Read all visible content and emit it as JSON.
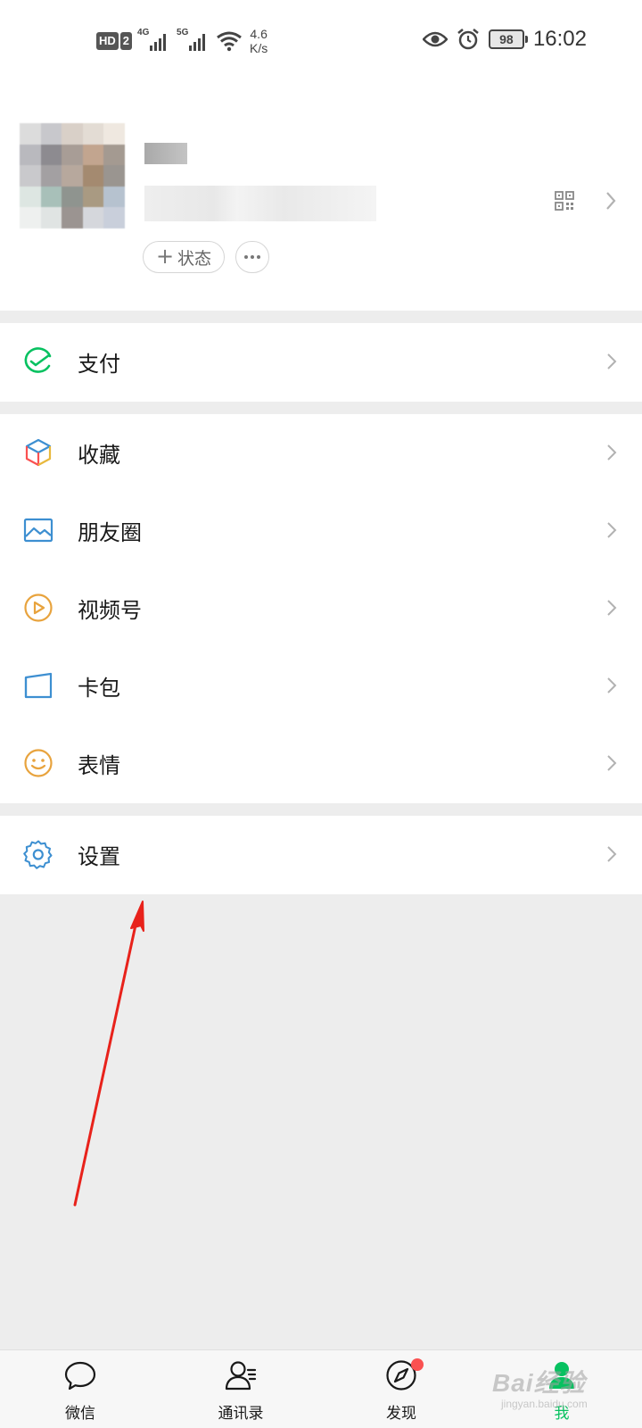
{
  "status_bar": {
    "hd_label": "HD",
    "sim_label": "2",
    "network_1": "4G",
    "network_2": "5G",
    "speed_value": "4.6",
    "speed_unit": "K/s",
    "battery": "98",
    "time": "16:02",
    "icons": [
      "eye-icon",
      "alarm-icon"
    ]
  },
  "profile": {
    "status_button": "状态",
    "icons": [
      "qr-code-icon",
      "chevron-right-icon",
      "more-icon"
    ]
  },
  "menu": {
    "pay": {
      "label": "支付",
      "icon": "pay-icon",
      "color": "#07c160"
    },
    "favorites": {
      "label": "收藏",
      "icon": "favorites-cube-icon"
    },
    "moments": {
      "label": "朋友圈",
      "icon": "moments-image-icon",
      "color": "#3d8fd1"
    },
    "channels": {
      "label": "视频号",
      "icon": "channels-play-icon",
      "color": "#e8a33d"
    },
    "card_wallet": {
      "label": "卡包",
      "icon": "card-wallet-icon",
      "color": "#3d8fd1"
    },
    "stickers": {
      "label": "表情",
      "icon": "sticker-smile-icon",
      "color": "#e8a33d"
    },
    "settings": {
      "label": "设置",
      "icon": "settings-gear-icon",
      "color": "#3d8fd1"
    }
  },
  "tabbar": {
    "tabs": [
      {
        "label": "微信",
        "icon": "chat-bubble-icon"
      },
      {
        "label": "通讯录",
        "icon": "contacts-icon"
      },
      {
        "label": "发现",
        "icon": "discover-compass-icon",
        "badge": true
      },
      {
        "label": "我",
        "icon": "me-icon",
        "active": true
      }
    ],
    "active_color": "#07c160",
    "badge_color": "#fa5151"
  },
  "watermark": {
    "line1": "Bai经验",
    "line2": "jingyan.baidu.com"
  },
  "annotation": {
    "arrow_color": "#e8221b"
  }
}
